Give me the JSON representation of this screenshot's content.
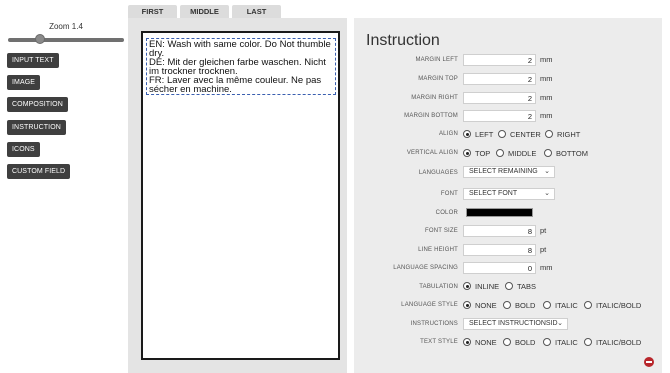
{
  "zoom": {
    "label": "Zoom 1.4",
    "level": 1.4
  },
  "sidebar": {
    "buttons": [
      "INPUT TEXT",
      "IMAGE",
      "COMPOSITION",
      "INSTRUCTION",
      "ICONS",
      "CUSTOM FIELD"
    ]
  },
  "tabs": [
    "FIRST",
    "MIDDLE",
    "LAST"
  ],
  "preview": {
    "lines": [
      "EN: Wash with same color. Do Not thumble dry.",
      "DE: Mit der gleichen farbe waschen. Nicht im trockner trocknen.",
      "FR: Laver avec la même couleur. Ne pas sécher en machine."
    ]
  },
  "instruction": {
    "title": "Instruction",
    "margin_left": {
      "label": "MARGIN LEFT",
      "value": "2",
      "unit": "mm"
    },
    "margin_top": {
      "label": "MARGIN TOP",
      "value": "2",
      "unit": "mm"
    },
    "margin_right": {
      "label": "MARGIN RIGHT",
      "value": "2",
      "unit": "mm"
    },
    "margin_bottom": {
      "label": "MARGIN BOTTOM",
      "value": "2",
      "unit": "mm"
    },
    "align": {
      "label": "ALIGN",
      "options": [
        "LEFT",
        "CENTER",
        "RIGHT"
      ],
      "selected": "LEFT"
    },
    "vertical_align": {
      "label": "VERTICAL ALIGN",
      "options": [
        "TOP",
        "MIDDLE",
        "BOTTOM"
      ],
      "selected": "TOP"
    },
    "languages": {
      "label": "LANGUAGES",
      "value": "SELECT REMAINING"
    },
    "font": {
      "label": "FONT",
      "value": "SELECT FONT"
    },
    "color": {
      "label": "COLOR",
      "value": "#000000"
    },
    "font_size": {
      "label": "FONT SIZE",
      "value": "8",
      "unit": "pt"
    },
    "line_height": {
      "label": "LINE HEIGHT",
      "value": "8",
      "unit": "pt"
    },
    "language_spacing": {
      "label": "LANGUAGE SPACING",
      "value": "0",
      "unit": "mm"
    },
    "tabulation": {
      "label": "TABULATION",
      "options": [
        "INLINE",
        "TABS"
      ],
      "selected": "INLINE"
    },
    "language_style": {
      "label": "LANGUAGE STYLE",
      "options": [
        "NONE",
        "BOLD",
        "ITALIC",
        "ITALIC/BOLD"
      ],
      "selected": "NONE"
    },
    "instructions": {
      "label": "INSTRUCTIONS",
      "value": "SELECT INSTRUCTIONSID"
    },
    "text_style": {
      "label": "TEXT STYLE",
      "options": [
        "NONE",
        "BOLD",
        "ITALIC",
        "ITALIC/BOLD"
      ],
      "selected": "NONE"
    }
  }
}
